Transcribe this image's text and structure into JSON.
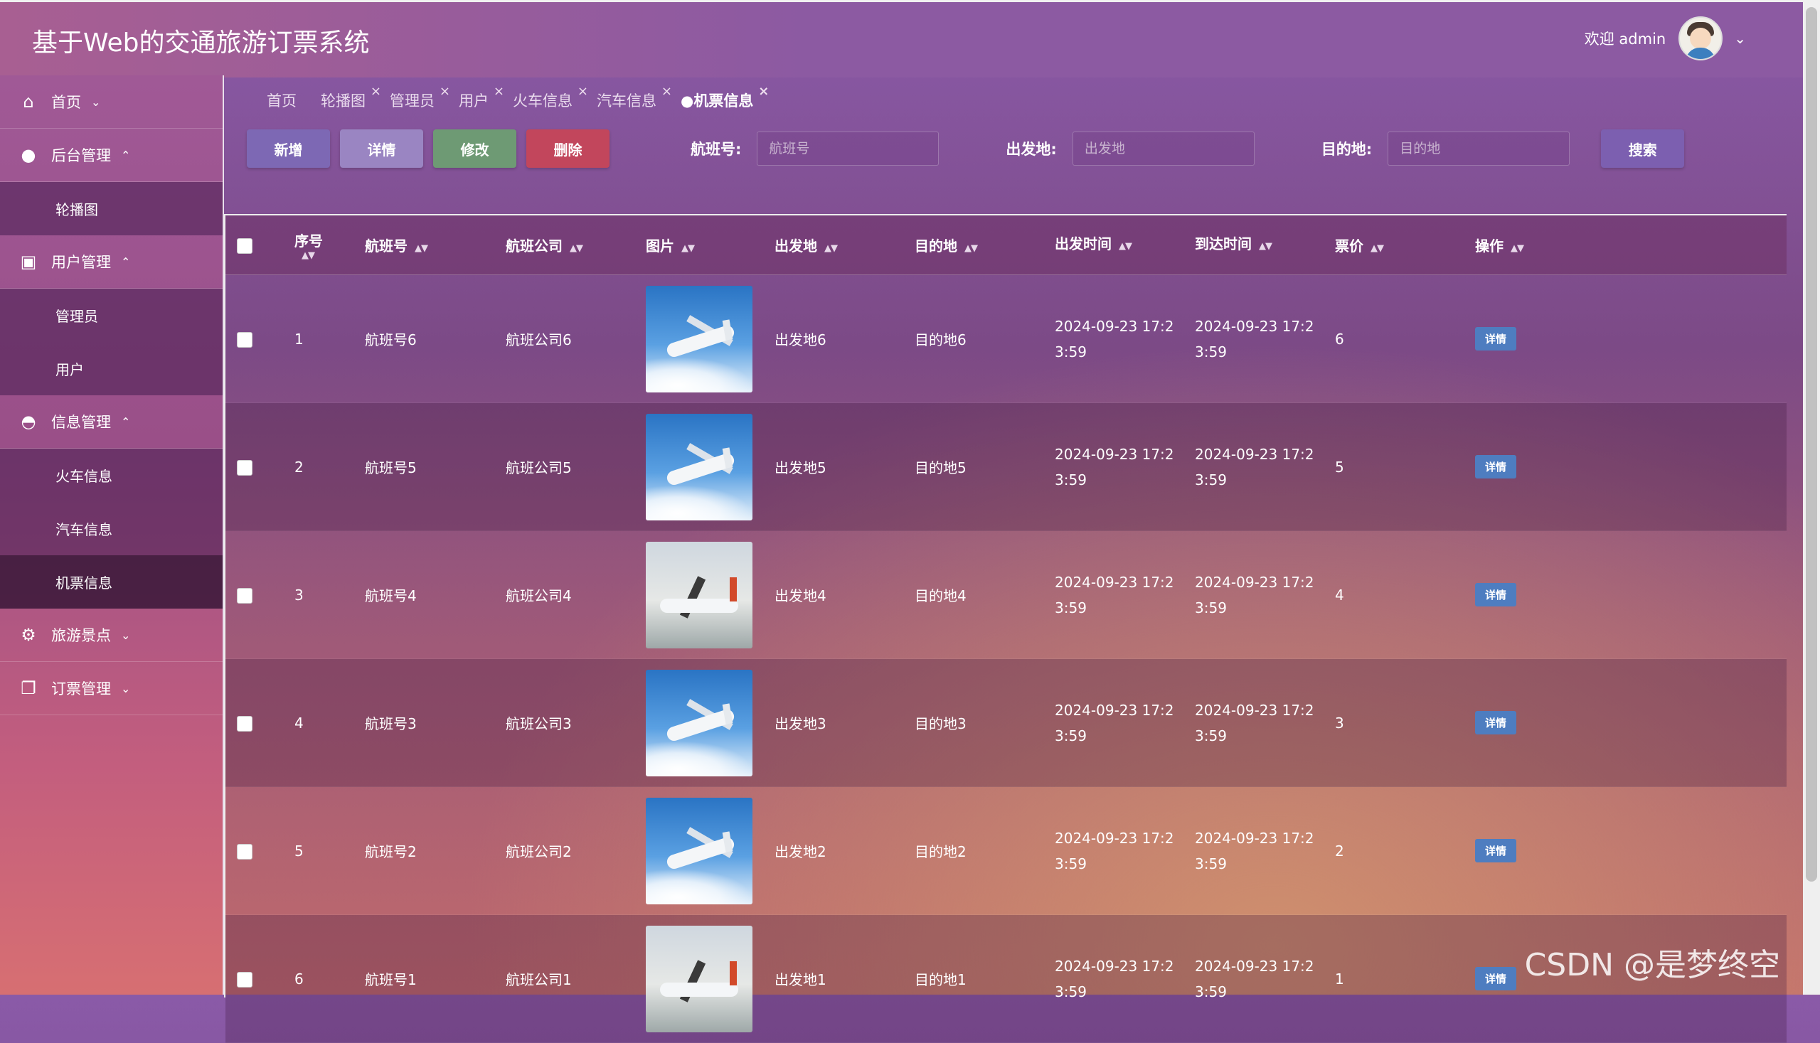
{
  "app": {
    "title": "基于Web的交通旅游订票系统"
  },
  "user": {
    "welcome": "欢迎 admin"
  },
  "sidebar": {
    "menus": [
      {
        "label": "首页",
        "icon": "home-icon",
        "caret": "⌄"
      },
      {
        "label": "后台管理",
        "icon": "chat-bubble-icon",
        "caret": "⌃",
        "children": [
          "轮播图"
        ]
      },
      {
        "label": "用户管理",
        "icon": "user-card-icon",
        "caret": "⌃",
        "children": [
          "管理员",
          "用户"
        ]
      },
      {
        "label": "信息管理",
        "icon": "spy-icon",
        "caret": "⌃",
        "children": [
          "火车信息",
          "汽车信息",
          "机票信息"
        ]
      },
      {
        "label": "旅游景点",
        "icon": "settings-icon",
        "caret": "⌄"
      },
      {
        "label": "订票管理",
        "icon": "documents-icon",
        "caret": "⌄"
      }
    ],
    "active_item": "机票信息"
  },
  "tabs": [
    {
      "label": "首页",
      "closable": false
    },
    {
      "label": "轮播图",
      "closable": true
    },
    {
      "label": "管理员",
      "closable": true
    },
    {
      "label": "用户",
      "closable": true
    },
    {
      "label": "火车信息",
      "closable": true
    },
    {
      "label": "汽车信息",
      "closable": true
    },
    {
      "label": "●机票信息",
      "closable": true,
      "active": true
    }
  ],
  "toolbar": {
    "add": "新增",
    "detail": "详情",
    "edit": "修改",
    "delete": "删除",
    "flight_label": "航班号:",
    "flight_placeholder": "航班号",
    "from_label": "出发地:",
    "from_placeholder": "出发地",
    "to_label": "目的地:",
    "to_placeholder": "目的地",
    "search": "搜索"
  },
  "table": {
    "headers": [
      "序号",
      "航班号",
      "航班公司",
      "图片",
      "出发地",
      "目的地",
      "出发时间",
      "到达时间",
      "票价",
      "操作"
    ],
    "rows": [
      {
        "idx": "1",
        "flight": "航班号6",
        "airline": "航班公司6",
        "image": "plane-sky-icon",
        "from": "出发地6",
        "to": "目的地6",
        "dep1": "2024-09-23 17:2",
        "dep2": "3:59",
        "arr1": "2024-09-23 17:2",
        "arr2": "3:59",
        "price": "6",
        "action": "详情"
      },
      {
        "idx": "2",
        "flight": "航班号5",
        "airline": "航班公司5",
        "image": "plane-sky-icon",
        "from": "出发地5",
        "to": "目的地5",
        "dep1": "2024-09-23 17:2",
        "dep2": "3:59",
        "arr1": "2024-09-23 17:2",
        "arr2": "3:59",
        "price": "5",
        "action": "详情"
      },
      {
        "idx": "3",
        "flight": "航班号4",
        "airline": "航班公司4",
        "image": "plane-ground-icon",
        "from": "出发地4",
        "to": "目的地4",
        "dep1": "2024-09-23 17:2",
        "dep2": "3:59",
        "arr1": "2024-09-23 17:2",
        "arr2": "3:59",
        "price": "4",
        "action": "详情"
      },
      {
        "idx": "4",
        "flight": "航班号3",
        "airline": "航班公司3",
        "image": "plane-sky-icon",
        "from": "出发地3",
        "to": "目的地3",
        "dep1": "2024-09-23 17:2",
        "dep2": "3:59",
        "arr1": "2024-09-23 17:2",
        "arr2": "3:59",
        "price": "3",
        "action": "详情"
      },
      {
        "idx": "5",
        "flight": "航班号2",
        "airline": "航班公司2",
        "image": "plane-sky-icon",
        "from": "出发地2",
        "to": "目的地2",
        "dep1": "2024-09-23 17:2",
        "dep2": "3:59",
        "arr1": "2024-09-23 17:2",
        "arr2": "3:59",
        "price": "2",
        "action": "详情"
      },
      {
        "idx": "6",
        "flight": "航班号1",
        "airline": "航班公司1",
        "image": "plane-ground-icon",
        "from": "出发地1",
        "to": "目的地1",
        "dep1": "2024-09-23 17:2",
        "dep2": "3:59",
        "arr1": "2024-09-23 17:2",
        "arr2": "3:59",
        "price": "1",
        "action": "详情"
      }
    ]
  },
  "watermark": "CSDN @是梦终空"
}
